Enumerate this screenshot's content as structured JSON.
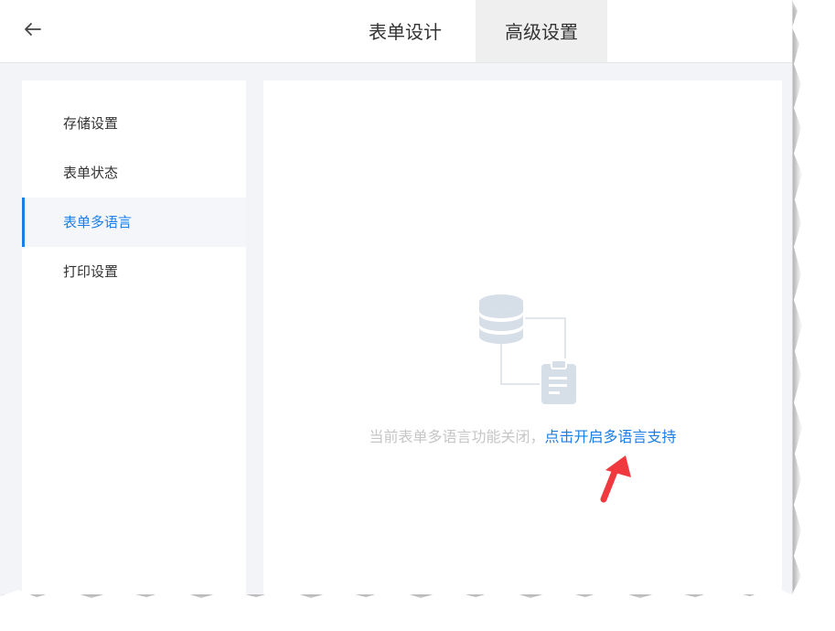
{
  "header": {
    "back_icon": "arrow-left-icon",
    "tabs": [
      {
        "label": "表单设计"
      },
      {
        "label": "高级设置"
      }
    ]
  },
  "sidebar": {
    "items": [
      {
        "label": "存储设置"
      },
      {
        "label": "表单状态"
      },
      {
        "label": "表单多语言"
      },
      {
        "label": "打印设置"
      }
    ]
  },
  "content": {
    "illustration_icon": "database-clipboard-icon",
    "message_prefix": "当前表单多语言功能关闭，",
    "message_link": "点击开启多语言支持",
    "annotation_icon": "red-arrow-icon"
  },
  "colors": {
    "accent": "#1a7ee6",
    "arrow": "#f0393f",
    "muted": "#c6c6c6"
  }
}
